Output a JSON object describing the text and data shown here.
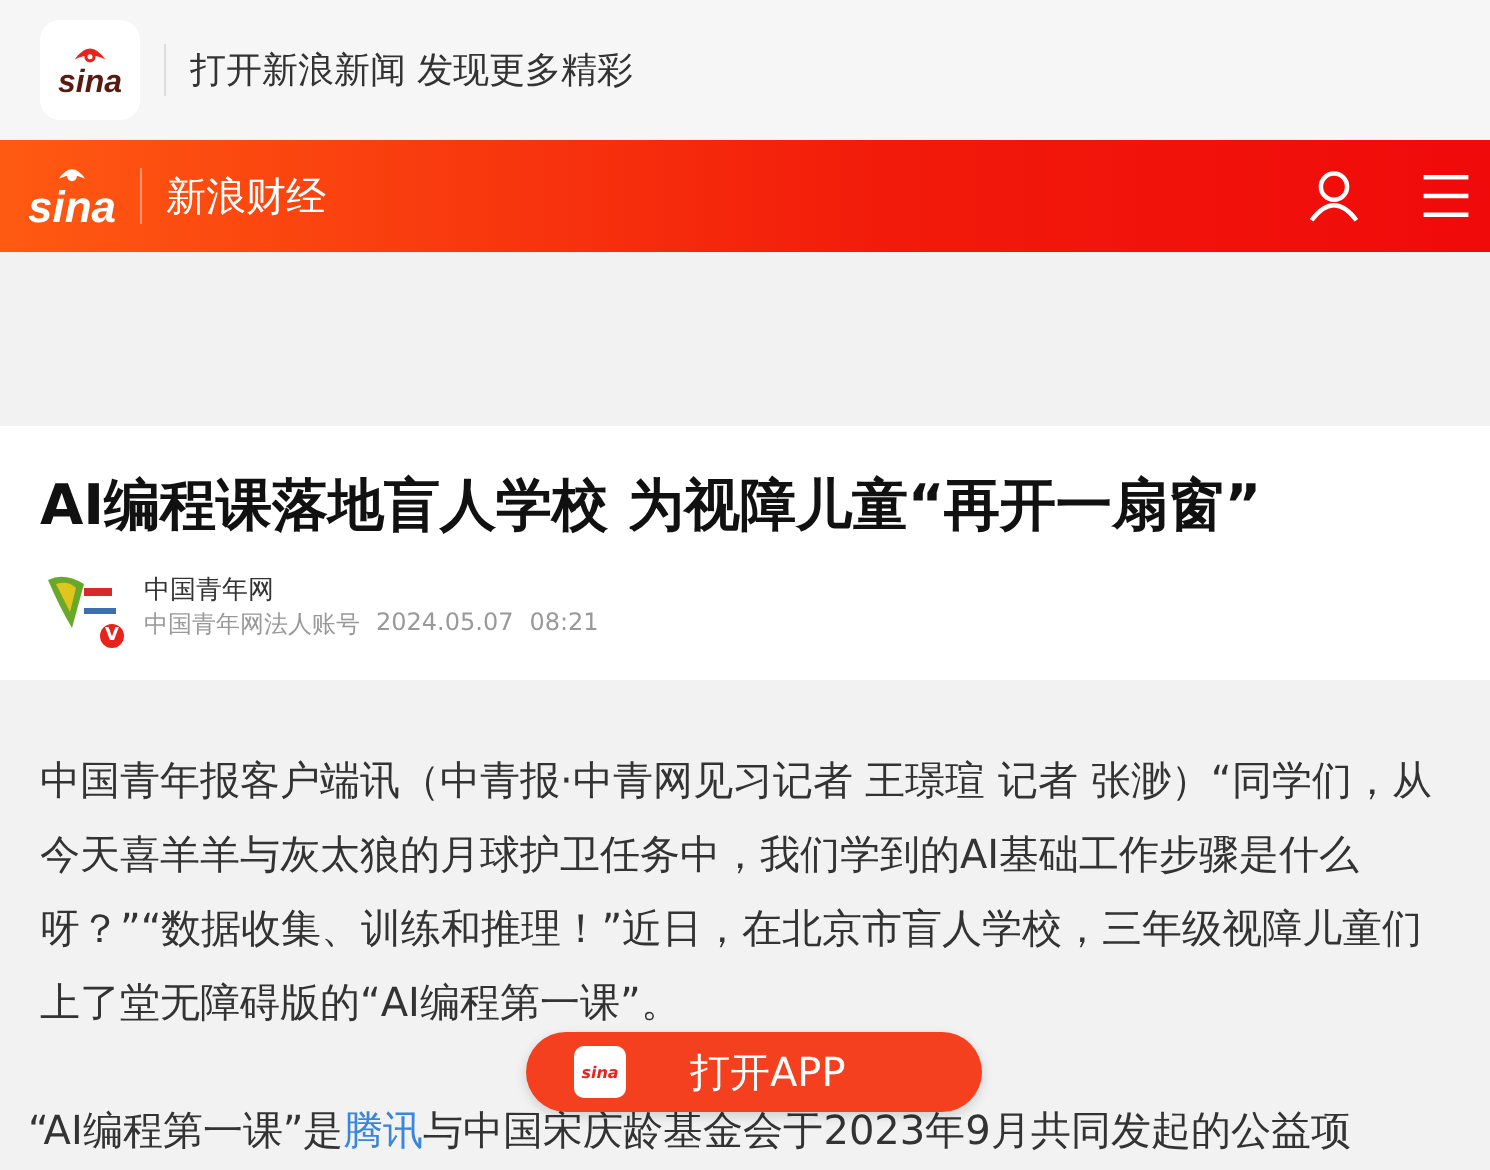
{
  "app_banner": {
    "logo": "sina",
    "text": "打开新浪新闻 发现更多精彩"
  },
  "header": {
    "logo": "sina",
    "channel": "新浪财经"
  },
  "article": {
    "title": "AI编程课落地盲人学校 为视障儿童“再开一扇窗”",
    "author": {
      "name": "中国青年网",
      "badge": "V",
      "account": "中国青年网法人账号",
      "date": "2024.05.07",
      "time": "08:21"
    },
    "paragraphs": [
      {
        "parts": [
          {
            "text": "中国青年报客户端讯（中青报·中青网见习记者 王璟瑄 记者 张渺）“同学们，从今天喜羊羊与灰太狼的月球护卫任务中，我们学到的AI基础工作步骤是什么呀？”“数据收集、训练和推理！”近日，在北京市盲人学校，三年级视障儿童们上了堂无障碍版的“AI编程第一课”。",
            "link": false
          }
        ]
      },
      {
        "parts": [
          {
            "text": "“AI编程第一课”是",
            "link": false
          },
          {
            "text": "腾讯",
            "link": true
          },
          {
            "text": "与中国宋庆龄基金会于2023年9月共同发起的公益项",
            "link": false
          }
        ]
      }
    ]
  },
  "open_app_button": {
    "logo": "sina",
    "label": "打开APP"
  }
}
